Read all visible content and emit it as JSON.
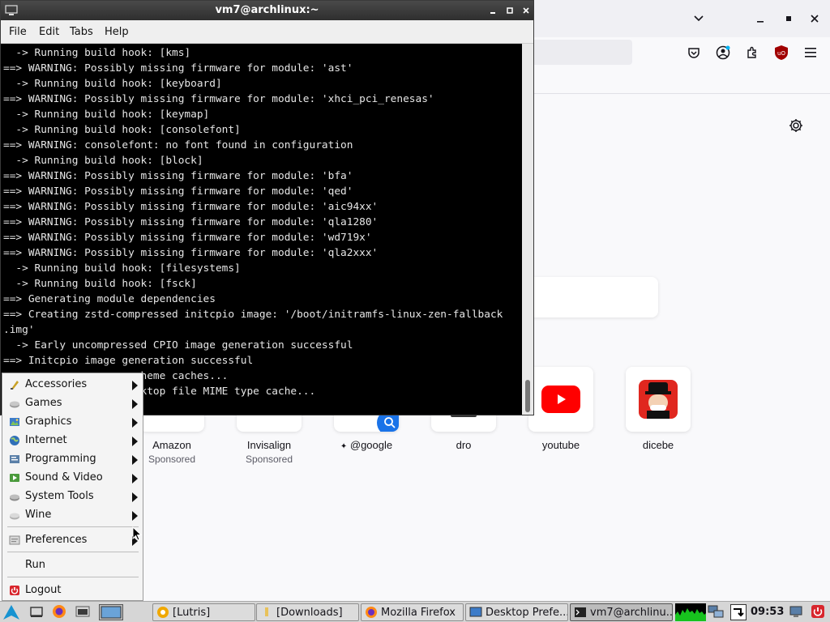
{
  "terminal": {
    "title": "vm7@archlinux:~",
    "menus": [
      "File",
      "Edit",
      "Tabs",
      "Help"
    ],
    "lines": [
      "  -> Running build hook: [kms]",
      "==> WARNING: Possibly missing firmware for module: 'ast'",
      "  -> Running build hook: [keyboard]",
      "==> WARNING: Possibly missing firmware for module: 'xhci_pci_renesas'",
      "  -> Running build hook: [keymap]",
      "  -> Running build hook: [consolefont]",
      "==> WARNING: consolefont: no font found in configuration",
      "  -> Running build hook: [block]",
      "==> WARNING: Possibly missing firmware for module: 'bfa'",
      "==> WARNING: Possibly missing firmware for module: 'qed'",
      "==> WARNING: Possibly missing firmware for module: 'aic94xx'",
      "==> WARNING: Possibly missing firmware for module: 'qla1280'",
      "==> WARNING: Possibly missing firmware for module: 'wd719x'",
      "==> WARNING: Possibly missing firmware for module: 'qla2xxx'",
      "  -> Running build hook: [filesystems]",
      "  -> Running build hook: [fsck]",
      "==> Generating module dependencies",
      "==> Creating zstd-compressed initcpio image: '/boot/initramfs-linux-zen-fallback",
      ".img'",
      "  -> Early uncompressed CPIO image generation successful",
      "==> Initcpio image generation successful",
      "                      heme caches...",
      "                      ktop file MIME type cache..."
    ]
  },
  "start_menu": {
    "categories": [
      {
        "label": "Accessories",
        "icon": "accessories-icon",
        "color": "#c9a227"
      },
      {
        "label": "Games",
        "icon": "games-icon",
        "color": "#9a9a9a"
      },
      {
        "label": "Graphics",
        "icon": "graphics-icon",
        "color": "#3d7cc9"
      },
      {
        "label": "Internet",
        "icon": "internet-icon",
        "color": "#2f6fb8"
      },
      {
        "label": "Programming",
        "icon": "programming-icon",
        "color": "#5a7fa8"
      },
      {
        "label": "Sound & Video",
        "icon": "sound-video-icon",
        "color": "#4a9a3c"
      },
      {
        "label": "System Tools",
        "icon": "system-tools-icon",
        "color": "#8a8a8a"
      },
      {
        "label": "Wine",
        "icon": "wine-icon",
        "color": "#b0b0b0"
      }
    ],
    "preferences": "Preferences",
    "run": "Run",
    "logout": "Logout"
  },
  "firefox": {
    "tiles": [
      {
        "label": "Amazon",
        "sponsor": "Sponsored"
      },
      {
        "label": "Invisalign",
        "sponsor": "Sponsored"
      },
      {
        "label": "@google",
        "sponsor": ""
      },
      {
        "label": "dro",
        "sponsor": ""
      },
      {
        "label": "youtube",
        "sponsor": ""
      },
      {
        "label": "dicebe",
        "sponsor": ""
      }
    ],
    "colors": {
      "youtube_red": "#ff0000",
      "google_blue": "#1a73e8"
    }
  },
  "taskbar": {
    "tasks": [
      {
        "label": "[Lutris]",
        "icon": "lutris-icon"
      },
      {
        "label": "[Downloads]",
        "icon": "folder-icon"
      },
      {
        "label": "Mozilla Firefox",
        "icon": "firefox-icon"
      },
      {
        "label": "Desktop Prefe...",
        "icon": "desktop-prefs-icon"
      },
      {
        "label": "vm7@archlinu...",
        "icon": "terminal-icon"
      }
    ],
    "clock": "09:53"
  }
}
